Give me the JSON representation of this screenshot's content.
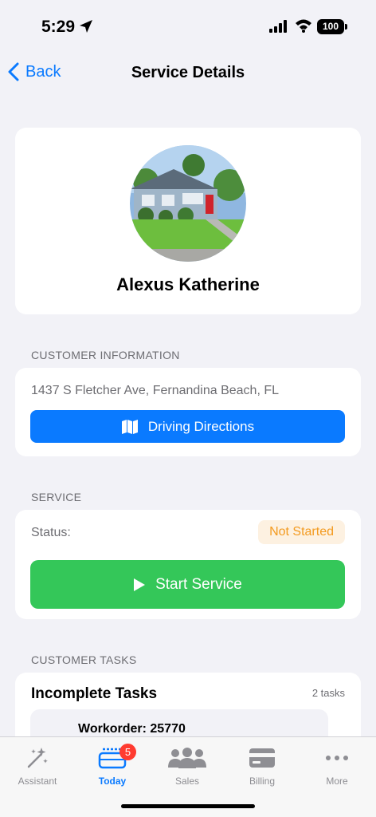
{
  "status_bar": {
    "time": "5:29",
    "battery": "100"
  },
  "nav": {
    "back_label": "Back",
    "title": "Service Details"
  },
  "profile": {
    "name": "Alexus Katherine",
    "avatar_icon": "house-photo"
  },
  "customer_info": {
    "header": "CUSTOMER INFORMATION",
    "address": "1437 S Fletcher Ave, Fernandina Beach, FL",
    "directions_label": "Driving Directions"
  },
  "service": {
    "header": "SERVICE",
    "status_label": "Status:",
    "status_value": "Not Started",
    "start_label": "Start Service"
  },
  "tasks": {
    "header": "CUSTOMER TASKS",
    "title": "Incomplete Tasks",
    "count": "2 tasks",
    "items": [
      {
        "title": "Workorder: 25770"
      }
    ]
  },
  "tab_bar": {
    "items": [
      {
        "label": "Assistant",
        "icon": "sparkles-icon"
      },
      {
        "label": "Today",
        "icon": "calendar-stack-icon",
        "badge": "5"
      },
      {
        "label": "Sales",
        "icon": "people-icon"
      },
      {
        "label": "Billing",
        "icon": "credit-card-icon"
      },
      {
        "label": "More",
        "icon": "ellipsis-icon"
      }
    ]
  },
  "colors": {
    "accent": "#0a7aff",
    "success": "#34c759",
    "warning": "#f39a1f",
    "badge": "#ff3b30"
  }
}
